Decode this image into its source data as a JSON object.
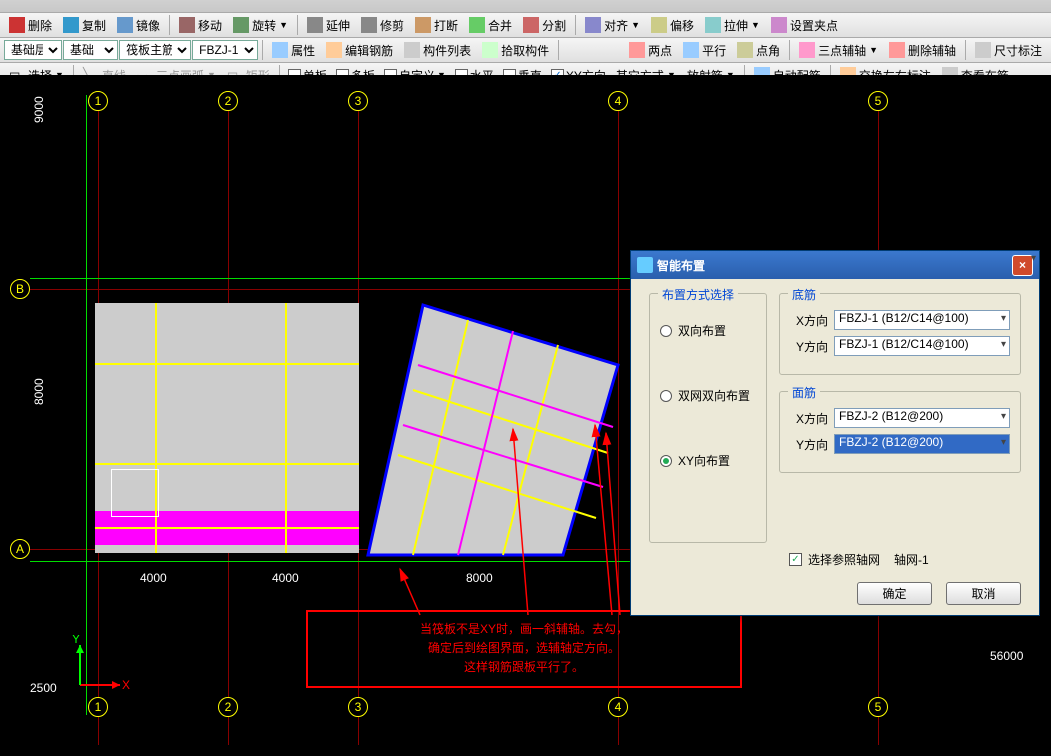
{
  "toolbar1": {
    "delete": "删除",
    "copy": "复制",
    "mirror": "镜像",
    "move": "移动",
    "rotate": "旋转",
    "extend": "延伸",
    "trim": "修剪",
    "break": "打断",
    "merge": "合并",
    "split": "分割",
    "align": "对齐",
    "offset": "偏移",
    "stretch": "拉伸",
    "setgrip": "设置夹点"
  },
  "toolbar2": {
    "layer": "基础层",
    "cat": "基础",
    "rebar_type": "筏板主筋",
    "code": "FBZJ-1",
    "props": "属性",
    "editbar": "编辑钢筋",
    "memberlist": "构件列表",
    "pick": "拾取构件",
    "twopoint": "两点",
    "parallel": "平行",
    "pointangle": "点角",
    "threepoint": "三点辅轴",
    "delaux": "删除辅轴",
    "dim": "尺寸标注"
  },
  "toolbar3": {
    "select": "选择",
    "line": "直线",
    "arc3": "三点画弧",
    "rect": "矩形",
    "single": "单板",
    "multi": "多板",
    "custom": "自定义",
    "horiz": "水平",
    "vert": "垂直",
    "xy": "XY方向",
    "other": "其它方式",
    "radial": "放射筋",
    "auto": "自动配筋",
    "swap": "交换左右标注",
    "view": "查看布筋"
  },
  "grid": {
    "cols": [
      "1",
      "2",
      "3",
      "4",
      "5"
    ],
    "rows": [
      "A",
      "B"
    ],
    "dim_4000": "4000",
    "dim_8000": "8000",
    "dim_9000": "9000",
    "dim_56000": "56000",
    "dim_2500": "2500"
  },
  "dialog": {
    "title": "智能布置",
    "grp_method": "布置方式选择",
    "radio_both": "双向布置",
    "radio_dual": "双网双向布置",
    "radio_xy": "XY向布置",
    "grp_bottom": "底筋",
    "grp_top": "面筋",
    "xdir": "X方向",
    "ydir": "Y方向",
    "bottom_x_val": "FBZJ-1 (B12/C14@100)",
    "bottom_y_val": "FBZJ-1 (B12/C14@100)",
    "top_x_val": "FBZJ-2 (B12@200)",
    "top_y_val": "FBZJ-2 (B12@200)",
    "ref_grid": "选择参照轴网",
    "ref_grid_val": "轴网-1",
    "ok": "确定",
    "cancel": "取消"
  },
  "anno": {
    "l1": "当筏板不是XY时，画一斜辅轴。去勾，",
    "l2": "确定后到绘图界面，选辅轴定方向。",
    "l3": "这样钢筋跟板平行了。"
  },
  "axis": {
    "x": "X",
    "y": "Y"
  },
  "icons": {
    "close": "×"
  }
}
